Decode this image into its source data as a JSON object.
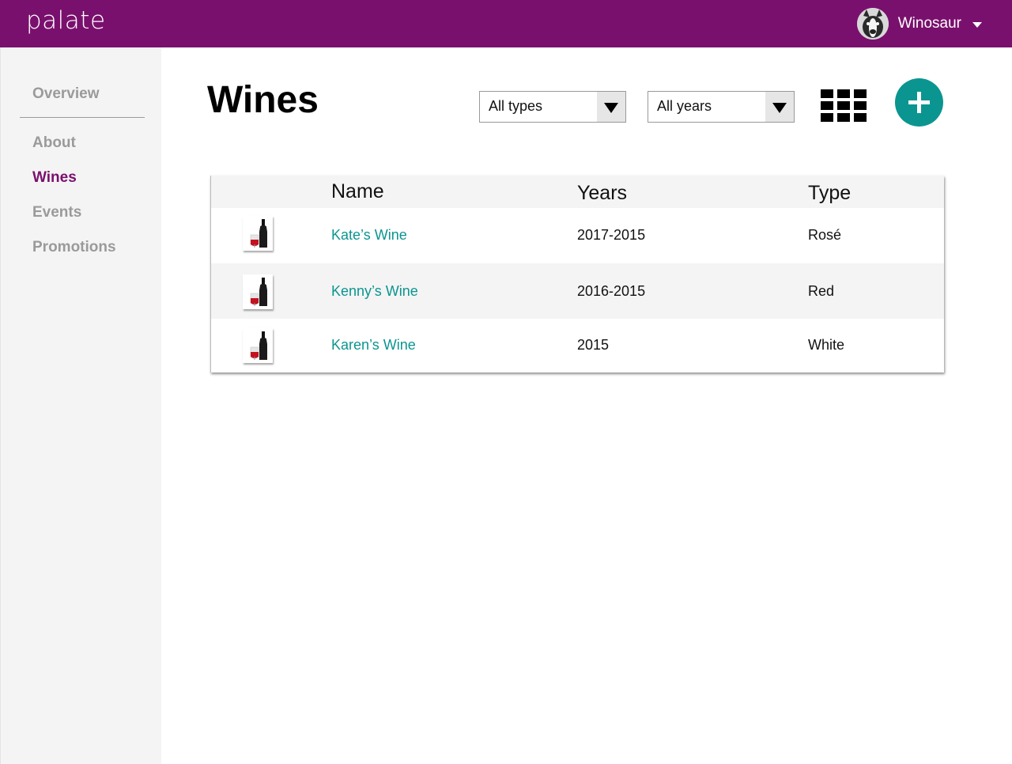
{
  "app": {
    "logo": "palate"
  },
  "user": {
    "name": "Winosaur",
    "avatar_icon": "dog-avatar-icon",
    "menu_icon": "caret-down-icon"
  },
  "sidebar": {
    "items": [
      {
        "id": "overview",
        "label": "Overview",
        "active": false
      },
      {
        "id": "about",
        "label": "About",
        "active": false
      },
      {
        "id": "wines",
        "label": "Wines",
        "active": true
      },
      {
        "id": "events",
        "label": "Events",
        "active": false
      },
      {
        "id": "promotions",
        "label": "Promotions",
        "active": false
      }
    ]
  },
  "main": {
    "title": "Wines",
    "filters": {
      "type": {
        "selected": "All types"
      },
      "year": {
        "selected": "All years"
      }
    },
    "view_toggle_icon": "grid-view-icon",
    "add_icon": "plus-icon"
  },
  "table": {
    "columns": {
      "name": "Name",
      "years": "Years",
      "type": "Type"
    },
    "rows": [
      {
        "name": "Kate’s Wine",
        "years": "2017-2015",
        "type": "Rosé",
        "thumb_icon": "wine-bottle-icon"
      },
      {
        "name": "Kenny’s Wine",
        "years": "2016-2015",
        "type": "Red",
        "thumb_icon": "wine-bottle-icon"
      },
      {
        "name": "Karen’s Wine",
        "years": "2015",
        "type": "White",
        "thumb_icon": "wine-bottle-icon"
      }
    ]
  },
  "colors": {
    "brand": "#7a106d",
    "accent": "#0b9590",
    "sidebar_bg": "#f4f4f4",
    "nav_inactive": "#9a9a9a"
  }
}
